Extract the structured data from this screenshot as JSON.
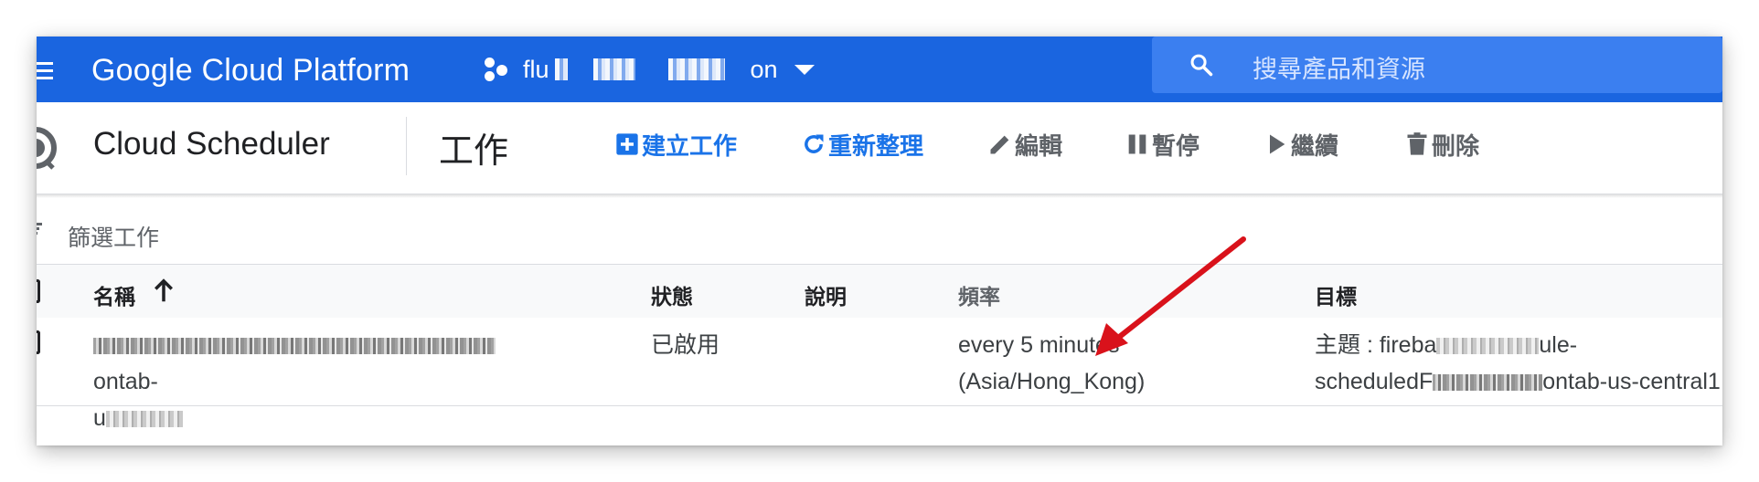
{
  "topbar": {
    "brand": "Google Cloud Platform",
    "project": {
      "prefix": "flu",
      "suffix": "on"
    },
    "search_placeholder": "搜尋產品和資源",
    "bar_color": "#1a65e0"
  },
  "actionbar": {
    "product_title": "Cloud Scheduler",
    "section_title": "工作",
    "actions": {
      "create": "建立工作",
      "refresh": "重新整理",
      "edit": "編輯",
      "pause": "暫停",
      "resume": "繼續",
      "delete": "刪除"
    }
  },
  "filter": {
    "placeholder": "篩選工作"
  },
  "table": {
    "columns": {
      "name": "名稱",
      "status": "狀態",
      "description": "說明",
      "frequency": "頻率",
      "target": "目標"
    },
    "rows": [
      {
        "name_line1_suffix": "ontab-",
        "name_line2_prefix": "u",
        "status": "已啟用",
        "description": "",
        "frequency_line1": "every 5 minutes",
        "frequency_line2": "(Asia/Hong_Kong)",
        "target_line1_prefix": "主題 : fireba",
        "target_line1_suffix": "ule-",
        "target_line2_prefix": "scheduledF",
        "target_line2_suffix": "ontab-us-central1"
      }
    ]
  },
  "annotation": {
    "arrow_color": "#d9121b"
  },
  "icons": [
    "menu-icon",
    "project-dots-icon",
    "chevron-down-icon",
    "search-icon",
    "scheduler-icon",
    "add-box-icon",
    "refresh-icon",
    "pencil-icon",
    "pause-icon",
    "play-icon",
    "trash-icon",
    "filter-icon",
    "arrow-up-icon"
  ]
}
